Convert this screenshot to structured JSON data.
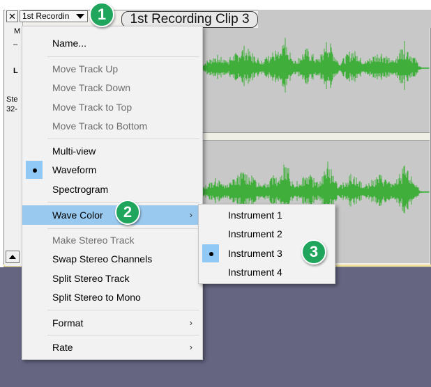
{
  "track": {
    "close_glyph": "✕",
    "name_button": "1st Recordin",
    "panel_letters": [
      "M",
      "–",
      "L",
      "Ste",
      "32-"
    ],
    "clip_title": "1st Recording Clip 3"
  },
  "track_menu": {
    "items": [
      {
        "label": "Name...",
        "enabled": true
      },
      {
        "label": "Move Track Up",
        "enabled": false
      },
      {
        "label": "Move Track Down",
        "enabled": false
      },
      {
        "label": "Move Track to Top",
        "enabled": false
      },
      {
        "label": "Move Track to Bottom",
        "enabled": false
      },
      {
        "label": "Multi-view",
        "enabled": true
      },
      {
        "label": "Waveform",
        "enabled": true,
        "checked": true
      },
      {
        "label": "Spectrogram",
        "enabled": true
      },
      {
        "label": "Wave Color",
        "enabled": true,
        "submenu": true,
        "highlighted": true
      },
      {
        "label": "Make Stereo Track",
        "enabled": false
      },
      {
        "label": "Swap Stereo Channels",
        "enabled": true
      },
      {
        "label": "Split Stereo Track",
        "enabled": true
      },
      {
        "label": "Split Stereo to Mono",
        "enabled": true
      },
      {
        "label": "Format",
        "enabled": true,
        "submenu": true
      },
      {
        "label": "Rate",
        "enabled": true,
        "submenu": true
      }
    ]
  },
  "wave_color_menu": {
    "items": [
      {
        "label": "Instrument 1"
      },
      {
        "label": "Instrument 2"
      },
      {
        "label": "Instrument 3",
        "checked": true
      },
      {
        "label": "Instrument 4"
      }
    ]
  },
  "callouts": [
    "1",
    "2",
    "3"
  ],
  "colors": {
    "waveform": "#3fae3a",
    "highlight": "#99c9ef",
    "callout": "#1fa55c",
    "background_below_tracks": "#656582"
  },
  "icons": {
    "submenu_arrow": "chevron-right-icon",
    "dropdown_arrow": "caret-down-icon",
    "close": "close-icon",
    "scroll": "scroll-up-icon"
  }
}
